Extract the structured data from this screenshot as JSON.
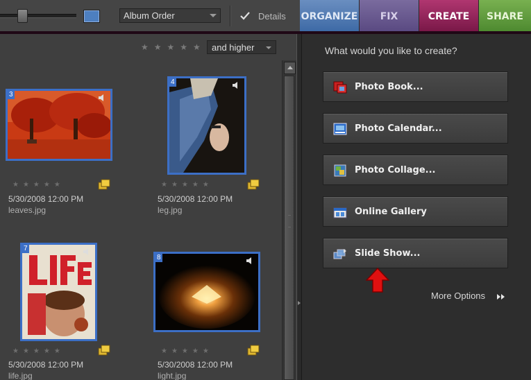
{
  "toolbar": {
    "sort_dropdown": "Album Order",
    "details_label": "Details",
    "details_checked": true,
    "tabs": {
      "organize": "ORGANIZE",
      "fix": "FIX",
      "create": "CREATE",
      "share": "SHARE"
    }
  },
  "filter": {
    "stars": "★★★★★",
    "rating_dropdown": "and higher"
  },
  "photos": [
    {
      "index": "3",
      "date": "5/30/2008 12:00 PM",
      "file": "leaves.jpg",
      "stars": "★★★★★"
    },
    {
      "index": "4",
      "date": "5/30/2008 12:00 PM",
      "file": "leg.jpg",
      "stars": "★★★★★"
    },
    {
      "index": "7",
      "date": "5/30/2008 12:00 PM",
      "file": "life.jpg",
      "stars": "★★★★★"
    },
    {
      "index": "8",
      "date": "5/30/2008 12:00 PM",
      "file": "light.jpg",
      "stars": "★★★★★"
    }
  ],
  "create_panel": {
    "prompt": "What would you like to create?",
    "options": [
      {
        "label": "Photo Book...",
        "icon": "photo-book-icon"
      },
      {
        "label": "Photo Calendar...",
        "icon": "photo-calendar-icon"
      },
      {
        "label": "Photo Collage...",
        "icon": "photo-collage-icon"
      },
      {
        "label": "Online Gallery",
        "icon": "online-gallery-icon"
      },
      {
        "label": "Slide Show...",
        "icon": "slide-show-icon"
      }
    ],
    "more_options": "More Options"
  },
  "colors": {
    "create_tab": "#b03670",
    "selection_border": "#3c6fc6",
    "annotation_arrow": "#e01010"
  }
}
